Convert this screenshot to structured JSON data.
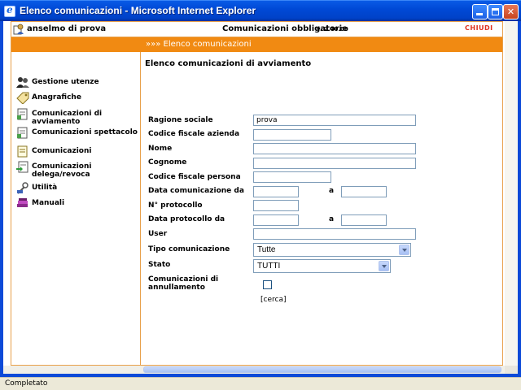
{
  "window": {
    "title": "Elenco comunicazioni - Microsoft Internet Explorer"
  },
  "header": {
    "user": "anselmo di prova",
    "app_title": "Comunicazioni obbligatorie",
    "version": "v. 2.40.00",
    "close_label": "CHIUDI"
  },
  "breadcrumb": "»»» Elenco comunicazioni",
  "sidebar": {
    "items": [
      {
        "label": "Gestione utenze",
        "icon": "users-icon"
      },
      {
        "label": "Anagrafiche",
        "icon": "tag-icon"
      },
      {
        "label": "Comunicazioni di avviamento",
        "icon": "document-icon"
      },
      {
        "label": "Comunicazioni spettacolo",
        "icon": "document-icon"
      },
      {
        "label": "Comunicazioni",
        "icon": "document-icon"
      },
      {
        "label": "Comunicazioni delega/revoca",
        "icon": "document-arrow-icon"
      },
      {
        "label": "Utilità",
        "icon": "tools-icon"
      },
      {
        "label": "Manuali",
        "icon": "books-icon"
      }
    ]
  },
  "main": {
    "heading": "Elenco comunicazioni di avviamento",
    "fields": {
      "ragione_sociale": {
        "label": "Ragione sociale",
        "value": "prova"
      },
      "codice_fiscale_azienda": {
        "label": "Codice fiscale azienda",
        "value": ""
      },
      "nome": {
        "label": "Nome",
        "value": ""
      },
      "cognome": {
        "label": "Cognome",
        "value": ""
      },
      "codice_fiscale_persona": {
        "label": "Codice fiscale persona",
        "value": ""
      },
      "data_comunicazione": {
        "label": "Data comunicazione da",
        "from": "",
        "to_label": "a",
        "to": ""
      },
      "n_protocollo": {
        "label": "N° protocollo",
        "value": ""
      },
      "data_protocollo": {
        "label": "Data protocollo da",
        "from": "",
        "to_label": "a",
        "to": ""
      },
      "user": {
        "label": "User",
        "value": ""
      },
      "tipo_comunicazione": {
        "label": "Tipo comunicazione",
        "selected": "Tutte"
      },
      "stato": {
        "label": "Stato",
        "selected": "TUTTI"
      },
      "comunicazioni_annullamento": {
        "label": "Comunicazioni di annullamento",
        "checked": false
      }
    },
    "search_label": "[cerca]"
  },
  "statusbar": {
    "text": "Completato"
  },
  "colors": {
    "accent": "#f18a12",
    "border": "#e8a04a",
    "close": "#e0301e",
    "window_blue": "#0c4ad8"
  }
}
